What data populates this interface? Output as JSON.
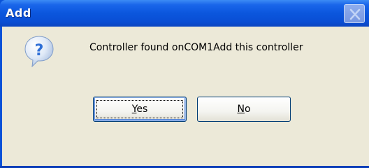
{
  "window": {
    "title": "Add",
    "close_icon": "close-icon"
  },
  "message": {
    "icon": "question-icon",
    "text": "Controller found onCOM1Add this controller"
  },
  "buttons": {
    "yes": {
      "mnemonic": "Y",
      "rest": "es"
    },
    "no": {
      "mnemonic": "N",
      "rest": "o"
    }
  },
  "colors": {
    "titlebar": "#0a52d8",
    "client": "#ece9d8",
    "icon_blue": "#2f6fd6"
  }
}
